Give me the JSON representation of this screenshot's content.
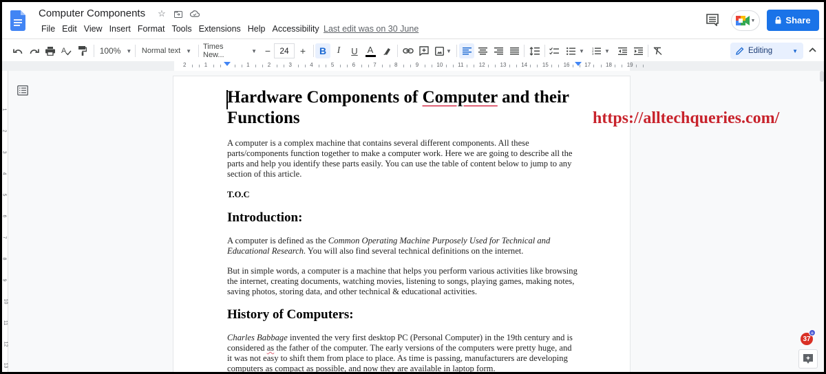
{
  "app": {
    "doc_title": "Computer Components",
    "last_edit": "Last edit was on 30 June",
    "share_label": "Share",
    "icons": {
      "logo": "google-docs-icon",
      "star": "☆",
      "move": "folder-move-icon",
      "cloud": "cloud-saved-icon"
    }
  },
  "menu": [
    "File",
    "Edit",
    "View",
    "Insert",
    "Format",
    "Tools",
    "Extensions",
    "Help",
    "Accessibility"
  ],
  "toolbar": {
    "zoom": "100%",
    "style": "Normal text",
    "font": "Times New...",
    "font_size": "24",
    "minus": "−",
    "plus": "+",
    "bold": "B",
    "italic": "I",
    "underline": "U",
    "text_color": "A",
    "mode": "Editing",
    "text_color_value": "#000000"
  },
  "ruler": {
    "labels": [
      "2",
      "1",
      "",
      "1",
      "2",
      "3",
      "4",
      "5",
      "6",
      "7",
      "8",
      "9",
      "10",
      "11",
      "12",
      "13",
      "14",
      "15",
      "16",
      "17",
      "18",
      "19"
    ]
  },
  "vruler": {
    "labels": [
      "1",
      "2",
      "3",
      "4",
      "5",
      "6",
      "7",
      "8",
      "9",
      "10",
      "11",
      "12",
      "13"
    ]
  },
  "document": {
    "title_part1": "Hardware Components of ",
    "title_spell": "Computer",
    "title_part2": " and their Functions",
    "intro_paragraph": "A computer is a complex machine that contains several different components. All these parts/components function together to make a computer work. Here we are going to describe all the parts and help you identify these parts easily. You can use the table of content below to jump to any section of this article.",
    "toc": "T.O.C",
    "h_introduction": "Introduction:",
    "def_part1": "A computer is defined as the ",
    "def_italic": "Common Operating Machine Purposely Used for Technical and Educational Research.",
    "def_part2": " You will also find several technical definitions on the internet.",
    "simple_words": "But in simple words, a computer is a machine that helps you perform various activities like browsing the internet, creating documents, watching movies, listening to songs, playing games, making notes, saving photos, storing data, and other technical & educational activities.",
    "h_history": "History of Computers:",
    "hist_italic": "Charles Babbage",
    "hist_part1": " invented the very first desktop PC (Personal Computer) in the 19th century and is considered ",
    "hist_spell": "as",
    "hist_part2": " the father of the computer. The early versions of the computers were pretty huge, and it was not easy to shift them from place to place. As time is passing, manufacturers are developing computers as compact as possible, and now they are available in laptop form."
  },
  "watermark": "https://alltechqueries.com/",
  "notifications": {
    "count": "37",
    "plus": "+"
  },
  "colors": {
    "accent": "#1a73e8",
    "watermark": "#c8232c",
    "badge": "#d93025"
  }
}
